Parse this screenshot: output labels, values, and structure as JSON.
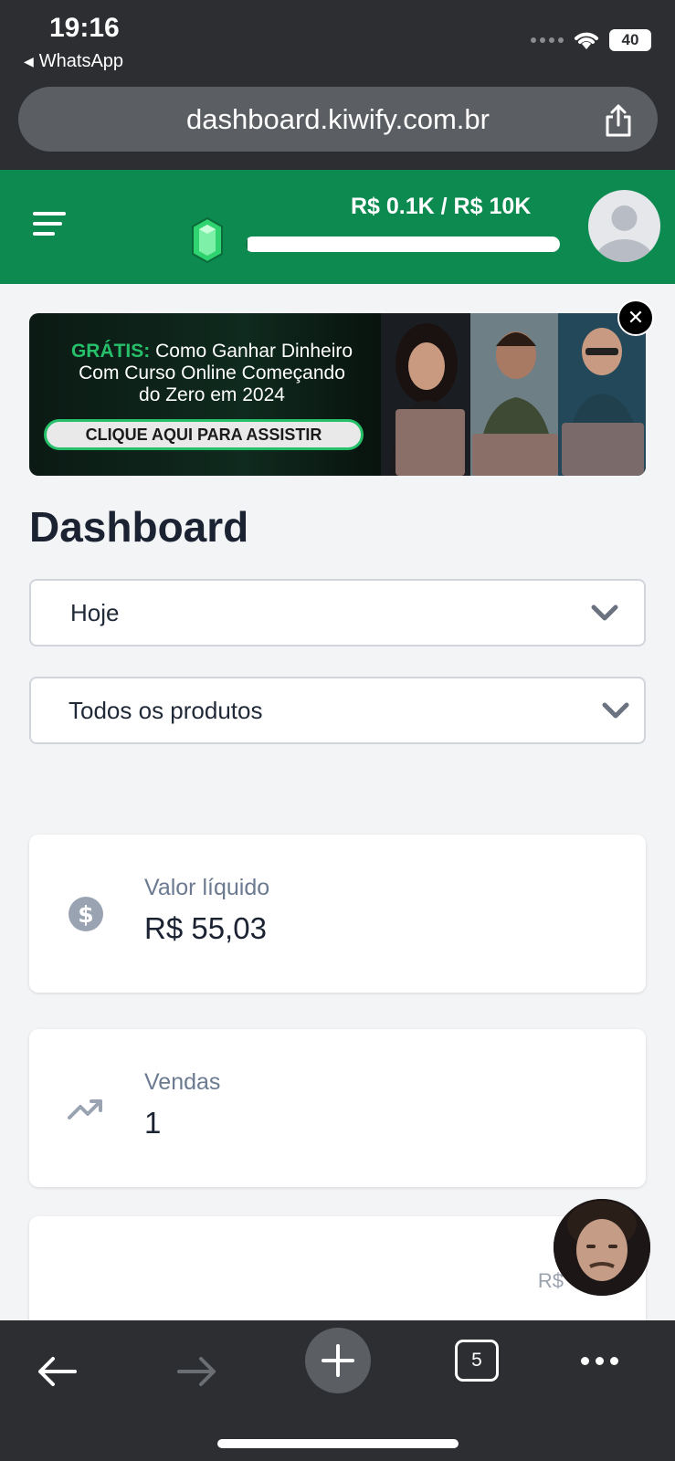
{
  "status_bar": {
    "time": "19:16",
    "back_app": "WhatsApp",
    "battery": "40"
  },
  "browser": {
    "url": "dashboard.kiwify.com.br",
    "open_tabs": "5"
  },
  "header": {
    "goal_text": "R$ 0.1K / R$ 10K",
    "goal_progress": 0.01
  },
  "banner": {
    "highlight": "GRÁTIS:",
    "line1": " Como Ganhar Dinheiro",
    "line2": "Com Curso Online Começando",
    "line3": "do Zero em 2024",
    "cta": "CLIQUE AQUI PARA ASSISTIR"
  },
  "page": {
    "title": "Dashboard"
  },
  "filters": {
    "period": "Hoje",
    "products": "Todos os produtos"
  },
  "cards": [
    {
      "label": "Valor líquido",
      "value": "R$ 55,03",
      "icon": "dollar-circle-icon"
    },
    {
      "label": "Vendas",
      "value": "1",
      "icon": "trending-up-icon"
    },
    {
      "partial_text": "R$"
    }
  ],
  "colors": {
    "brand_green": "#0c8a4f",
    "browser_chrome": "#2c2e31",
    "page_bg": "#f3f4f6"
  }
}
